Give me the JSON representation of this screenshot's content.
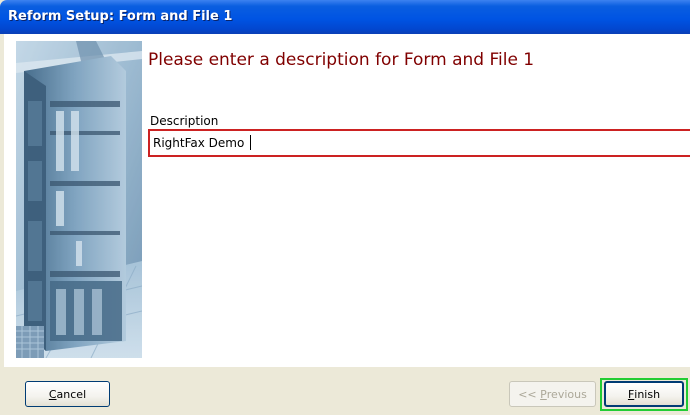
{
  "window": {
    "title": "Reform Setup: Form and File 1"
  },
  "main": {
    "heading": "Please enter a description for Form and File 1",
    "description_label": "Description",
    "description_value": "RightFax Demo"
  },
  "buttons": {
    "cancel": {
      "accel": "C",
      "rest": "ancel"
    },
    "previous": {
      "prefix": "<< ",
      "accel": "P",
      "rest": "revious",
      "enabled": false
    },
    "finish": {
      "accel": "F",
      "rest": "inish"
    }
  },
  "colors": {
    "title_bar": "#0054e3",
    "heading": "#800000",
    "input_border": "#cc2222",
    "focus_highlight": "#22cc33",
    "background": "#ece9d8"
  }
}
